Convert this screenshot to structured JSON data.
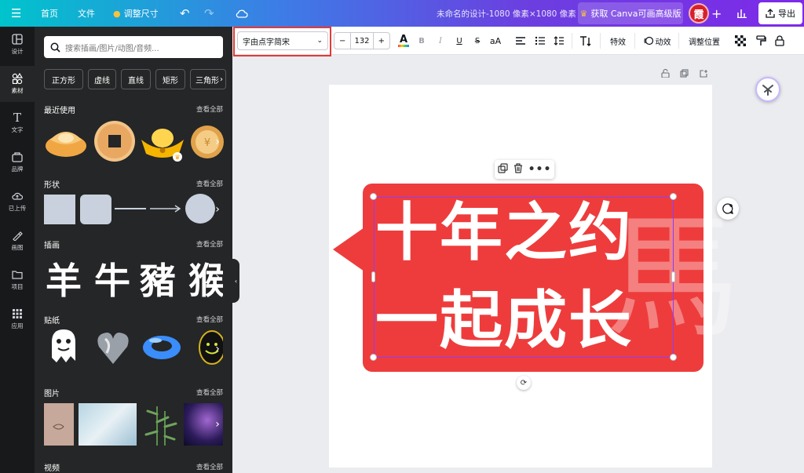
{
  "topbar": {
    "home": "首页",
    "file": "文件",
    "resize": "调整尺寸",
    "title": "未命名的设计-1080 像素×1080 像素",
    "pro": "获取 Canva可画高级版",
    "avatar": "霞",
    "export": "导出"
  },
  "rail": [
    {
      "label": "设计",
      "icon": "layout-icon"
    },
    {
      "label": "素材",
      "icon": "elements-icon"
    },
    {
      "label": "文字",
      "icon": "text-icon"
    },
    {
      "label": "品牌",
      "icon": "brand-icon"
    },
    {
      "label": "已上传",
      "icon": "upload-icon"
    },
    {
      "label": "画图",
      "icon": "draw-icon"
    },
    {
      "label": "项目",
      "icon": "folder-icon"
    },
    {
      "label": "应用",
      "icon": "apps-icon"
    }
  ],
  "panel": {
    "search_placeholder": "搜索插画/图片/动图/音频...",
    "chips": [
      "正方形",
      "虚线",
      "直线",
      "矩形",
      "三角形"
    ],
    "see_all": "查看全部",
    "sections": {
      "recent": "最近使用",
      "shapes": "形状",
      "illustrations": "插画",
      "stickers": "贴纸",
      "photos": "图片",
      "videos": "视频"
    },
    "illus_chars": [
      "羊",
      "牛",
      "豬",
      "猴"
    ]
  },
  "toolbar": {
    "font": "字由点字简宋",
    "size": "132",
    "effects": "特效",
    "animate": "动效",
    "position": "调整位置"
  },
  "canvas": {
    "line1": "十年之约",
    "line2": "一起成长",
    "watermark": "馬"
  },
  "colors": {
    "accent": "#8b3dff",
    "card": "#ee3c3c",
    "highlight": "#e53935"
  }
}
